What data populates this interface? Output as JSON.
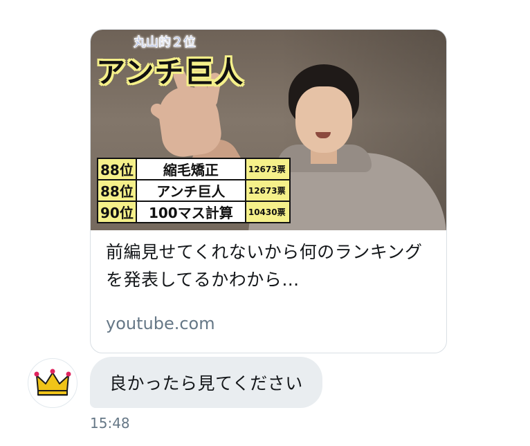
{
  "link_card": {
    "thumbnail": {
      "caption_small": "丸山的２位",
      "caption_big": "アンチ巨人",
      "ranking_rows": [
        {
          "rank": "88位",
          "name": "縮毛矯正",
          "votes": "12673票"
        },
        {
          "rank": "88位",
          "name": "アンチ巨人",
          "votes": "12673票"
        },
        {
          "rank": "90位",
          "name": "100マス計算",
          "votes": "10430票"
        }
      ],
      "highlight_color": "#f5f08a"
    },
    "title": "前編見せてくれないから何のランキングを発表してるかわから…",
    "domain": "youtube.com"
  },
  "message": {
    "avatar_icon": "crown-icon",
    "text": "良かったら見てください",
    "timestamp": "15:48"
  },
  "colors": {
    "bubble_bg": "#e9edf0",
    "secondary_text": "#657786",
    "primary_text": "#14171a",
    "crown_gold": "#f0c419"
  }
}
